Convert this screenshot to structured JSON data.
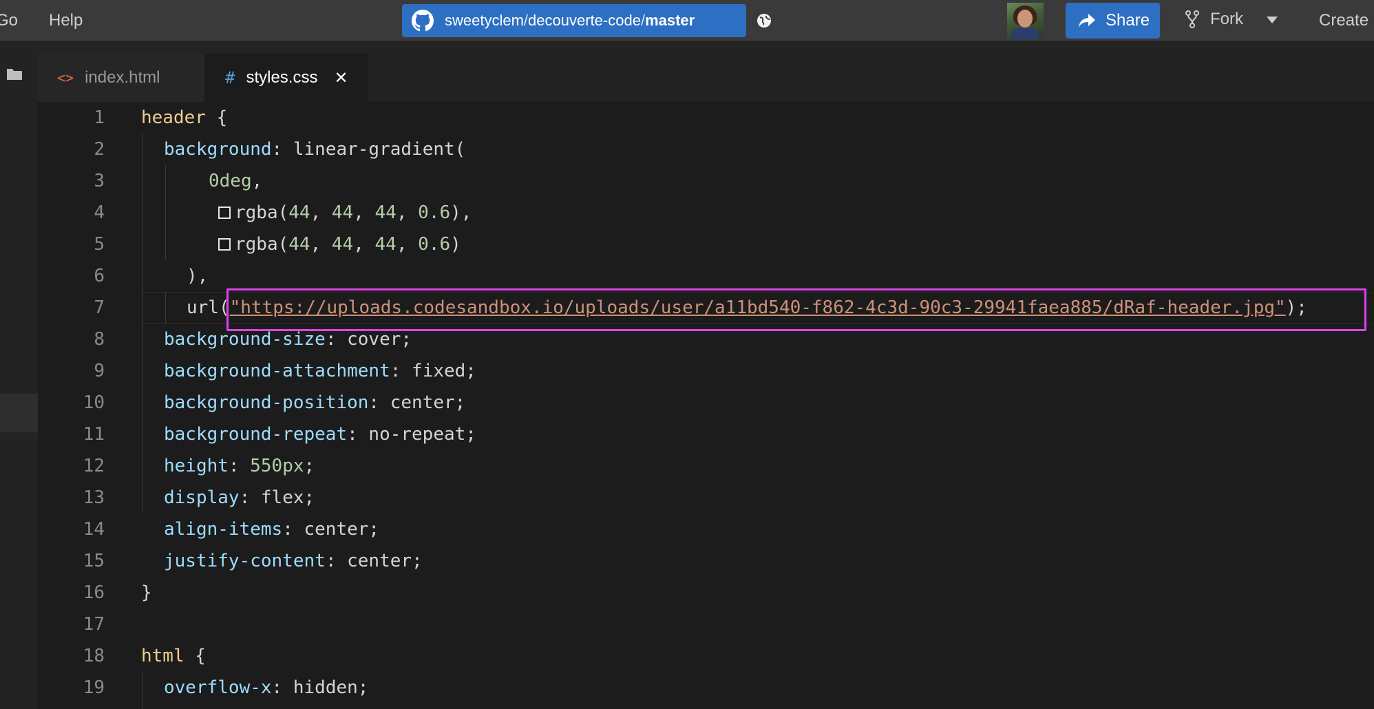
{
  "menu": {
    "go": "Go",
    "help": "Help"
  },
  "repo": {
    "owner": "sweetyclem",
    "sep1": " / ",
    "name": "decouverte-code",
    "sep2": " / ",
    "branch": "master"
  },
  "actions": {
    "share": "Share",
    "fork": "Fork",
    "create": "Create"
  },
  "tabs": [
    {
      "label": "index.html",
      "icon": "html-code-icon"
    },
    {
      "label": "styles.css",
      "icon": "css-hash-icon",
      "active": true
    }
  ],
  "editor": {
    "lines": [
      {
        "n": "1"
      },
      {
        "n": "2"
      },
      {
        "n": "3"
      },
      {
        "n": "4"
      },
      {
        "n": "5"
      },
      {
        "n": "6"
      },
      {
        "n": "7"
      },
      {
        "n": "8"
      },
      {
        "n": "9"
      },
      {
        "n": "10"
      },
      {
        "n": "11"
      },
      {
        "n": "12"
      },
      {
        "n": "13"
      },
      {
        "n": "14"
      },
      {
        "n": "15"
      },
      {
        "n": "16"
      },
      {
        "n": "17"
      },
      {
        "n": "18"
      },
      {
        "n": "19"
      }
    ],
    "code": {
      "l1_sel": "header",
      "l1_b": " {",
      "l2_prop": "background",
      "l2_val": ": linear-gradient(",
      "l3_num": "0deg",
      "l3_p": ",",
      "l4_fn": "rgba(",
      "l4_a": "44",
      "l4_b": "44",
      "l4_c": "44",
      "l4_d": "0.6",
      "l4_end": "),",
      "l5_fn": "rgba(",
      "l5_a": "44",
      "l5_b": "44",
      "l5_c": "44",
      "l5_d": "0.6",
      "l5_end": ")",
      "l6": "),",
      "l7_fn": "url(",
      "l7_str": "\"https://uploads.codesandbox.io/uploads/user/a11bd540-f862-4c3d-90c3-29941faea885/dRaf-header.jpg\"",
      "l7_end": ");",
      "l8_prop": "background-size",
      "l8_val": ": cover;",
      "l9_prop": "background-attachment",
      "l9_val": ": fixed;",
      "l10_prop": "background-position",
      "l10_val": ": center;",
      "l11_prop": "background-repeat",
      "l11_val": ": no-repeat;",
      "l12_prop": "height",
      "l12_c": ": ",
      "l12_num": "550px",
      "l12_end": ";",
      "l13_prop": "display",
      "l13_val": ": flex;",
      "l14_prop": "align-items",
      "l14_val": ": center;",
      "l15_prop": "justify-content",
      "l15_val": ": center;",
      "l16": "}",
      "l18_sel": "html",
      "l18_b": " {",
      "l19_prop": "overflow-x",
      "l19_val": ": hidden;"
    }
  },
  "colors": {
    "accent": "#2d6fc2",
    "annotation": "#e040e8",
    "selector": "#f0cd92",
    "property": "#9cdcfe",
    "number": "#b5cea8",
    "string": "#ce9178"
  }
}
